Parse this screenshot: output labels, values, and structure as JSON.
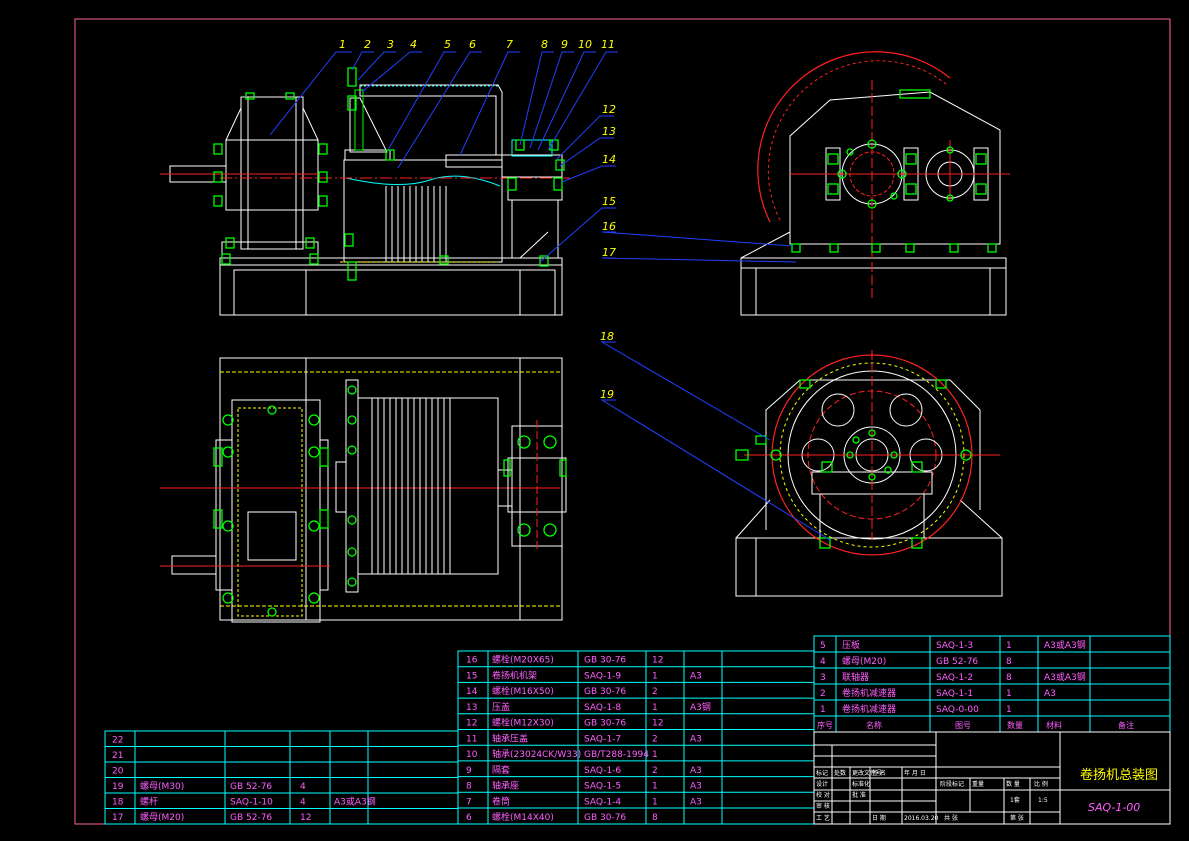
{
  "balloons": [
    "1",
    "2",
    "3",
    "4",
    "5",
    "6",
    "7",
    "8",
    "9",
    "10",
    "11",
    "12",
    "13",
    "14",
    "15",
    "16",
    "17",
    "18",
    "19"
  ],
  "bom_left": [
    {
      "no": "22",
      "name": "",
      "code": "",
      "qty": "",
      "mat": ""
    },
    {
      "no": "21",
      "name": "",
      "code": "",
      "qty": "",
      "mat": ""
    },
    {
      "no": "20",
      "name": "",
      "code": "",
      "qty": "",
      "mat": ""
    },
    {
      "no": "19",
      "name": "螺母(M30)",
      "code": "GB 52-76",
      "qty": "4",
      "mat": ""
    },
    {
      "no": "18",
      "name": "螺杆",
      "code": "SAQ-1-10",
      "qty": "4",
      "mat": "A3或A3钢"
    },
    {
      "no": "17",
      "name": "螺母(M20)",
      "code": "GB 52-76",
      "qty": "12",
      "mat": ""
    }
  ],
  "bom_mid": [
    {
      "no": "16",
      "name": "螺栓(M20X65)",
      "code": "GB 30-76",
      "qty": "12",
      "mat": ""
    },
    {
      "no": "15",
      "name": "卷扬机机架",
      "code": "SAQ-1-9",
      "qty": "1",
      "mat": "A3"
    },
    {
      "no": "14",
      "name": "螺栓(M16X50)",
      "code": "GB 30-76",
      "qty": "2",
      "mat": ""
    },
    {
      "no": "13",
      "name": "压盖",
      "code": "SAQ-1-8",
      "qty": "1",
      "mat": "A3钢"
    },
    {
      "no": "12",
      "name": "螺栓(M12X30)",
      "code": "GB 30-76",
      "qty": "12",
      "mat": ""
    },
    {
      "no": "11",
      "name": "轴承压盖",
      "code": "SAQ-1-7",
      "qty": "2",
      "mat": "A3"
    },
    {
      "no": "10",
      "name": "轴承(23024CK/W33)",
      "code": "GB/T288-1994",
      "qty": "1",
      "mat": ""
    },
    {
      "no": "9",
      "name": "隔套",
      "code": "SAQ-1-6",
      "qty": "2",
      "mat": "A3"
    },
    {
      "no": "8",
      "name": "轴承座",
      "code": "SAQ-1-5",
      "qty": "1",
      "mat": "A3"
    },
    {
      "no": "7",
      "name": "卷筒",
      "code": "SAQ-1-4",
      "qty": "1",
      "mat": "A3"
    },
    {
      "no": "6",
      "name": "螺栓(M14X40)",
      "code": "GB 30-76",
      "qty": "8",
      "mat": ""
    }
  ],
  "bom_right": [
    {
      "no": "5",
      "name": "压板",
      "code": "SAQ-1-3",
      "qty": "1",
      "mat": "A3或A3钢"
    },
    {
      "no": "4",
      "name": "螺母(M20)",
      "code": "GB 52-76",
      "qty": "8",
      "mat": ""
    },
    {
      "no": "3",
      "name": "联轴器",
      "code": "SAQ-1-2",
      "qty": "8",
      "mat": "A3或A3钢"
    },
    {
      "no": "2",
      "name": "卷扬机减速器",
      "code": "SAQ-1-1",
      "qty": "1",
      "mat": "A3"
    },
    {
      "no": "1",
      "name": "卷扬机减速器",
      "code": "SAQ-0-00",
      "qty": "1",
      "mat": ""
    }
  ],
  "bom_header": {
    "no": "序号",
    "name": "名称",
    "code": "图号",
    "qty": "数量",
    "mat": "材料",
    "remark": "备注"
  },
  "title_block": {
    "title": "卷扬机总装图",
    "drawing_no": "SAQ-1-00",
    "scale_label": "比 例",
    "scale": "1:5",
    "qty_label": "数 量",
    "qty": "1套",
    "sheet_label": "第 张",
    "total_label": "共 张",
    "design": "设计",
    "check": "校 对",
    "approve": "审 核",
    "process": "工 艺",
    "date_label": "日 期",
    "date": "2016.03.20",
    "std": "标准化",
    "approve2": "批 准",
    "mark_label": "标记",
    "count_label": "处数",
    "zone_label": "分区",
    "file_label": "更改文件号",
    "sign_label": "签 名",
    "ymd_label": "年 月 日",
    "stage_label": "阶段标记",
    "weight_label": "重量"
  }
}
